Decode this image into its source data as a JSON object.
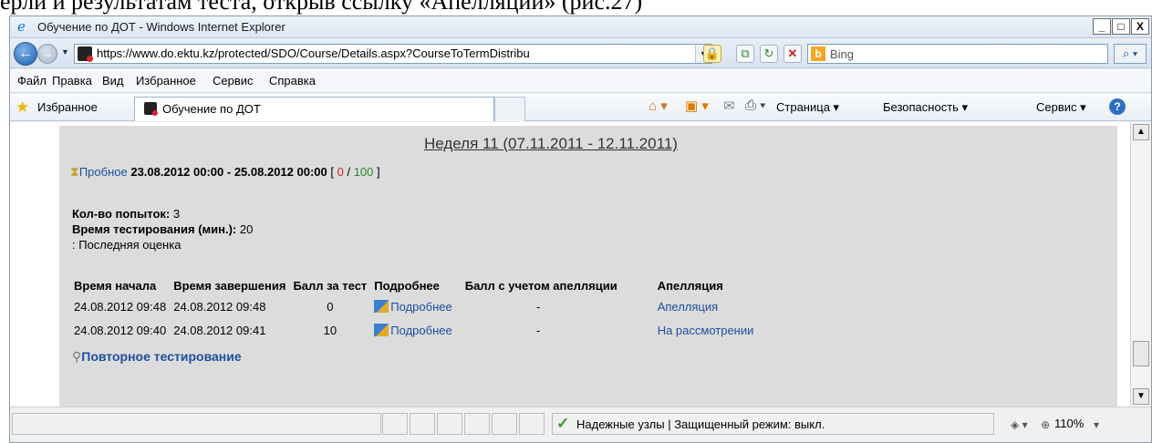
{
  "document_heading": "ерли и результатам теста, открыв ссылку «Апелляции» (рис.27)",
  "window": {
    "title": "Обучение по ДОТ - Windows Internet Explorer",
    "buttons": {
      "minimize": "_",
      "maximize": "□",
      "close": "X"
    }
  },
  "address": {
    "url": "https://www.do.ektu.kz/protected/SDO/Course/Details.aspx?CourseToTermDistribu",
    "search_placeholder": "Bing"
  },
  "menu": [
    "Файл",
    "Правка",
    "Вид",
    "Избранное",
    "Сервис",
    "Справка"
  ],
  "favorites": {
    "label": "Избранное",
    "tab_title": "Обучение по ДОТ",
    "commands": [
      "Страница ▾",
      "Безопасность ▾",
      "Сервис ▾"
    ]
  },
  "content": {
    "week_heading": "Неделя 11 (07.11.2011 - 12.11.2011)",
    "test": {
      "link": "Пробное",
      "dates": "23.08.2012 00:00 - 25.08.2012 00:00",
      "score_open": "[ ",
      "score_current": "0",
      "score_sep": " / ",
      "score_max": "100",
      "score_close": " ]"
    },
    "attempts_label": "Кол-во попыток:",
    "attempts_value": "3",
    "time_label": "Время тестирования (мин.):",
    "time_value": "20",
    "grading": ": Последняя оценка",
    "table": {
      "headers": [
        "Время начала",
        "Время завершения",
        "Балл за тест",
        "Подробнее",
        "Балл с учетом апелляции",
        "Апелляция"
      ],
      "rows": [
        {
          "start": "24.08.2012 09:48",
          "end": "24.08.2012 09:48",
          "score": "0",
          "details": "Подробнее",
          "appeal_score": "-",
          "appeal": "Апелляция"
        },
        {
          "start": "24.08.2012 09:40",
          "end": "24.08.2012 09:41",
          "score": "10",
          "details": "Подробнее",
          "appeal_score": "-",
          "appeal": "На рассмотрении"
        }
      ]
    },
    "retest": "Повторное тестирование"
  },
  "status": {
    "zone": "Надежные узлы | Защищенный режим: выкл.",
    "zoom": "110%"
  }
}
